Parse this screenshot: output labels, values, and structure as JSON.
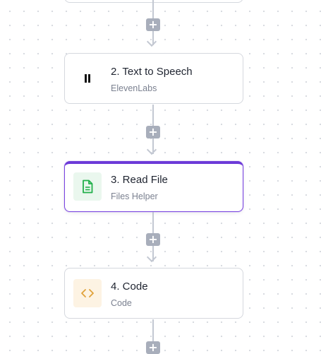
{
  "canvas": {
    "add_step_label": "+"
  },
  "steps": [
    {
      "title": "2. Text to Speech",
      "subtitle": "ElevenLabs",
      "icon": "pause-icon",
      "selected": false
    },
    {
      "title": "3. Read File",
      "subtitle": "Files Helper",
      "icon": "file-icon",
      "selected": true
    },
    {
      "title": "4. Code",
      "subtitle": "Code",
      "icon": "code-icon",
      "selected": false
    }
  ],
  "colors": {
    "accent": "#6c3ad8",
    "connector": "#c3c8d2",
    "add_button": "#a8aebb",
    "file_icon": "#22b04b",
    "file_icon_bg": "#eaf7ee",
    "code_icon": "#e0a23a",
    "code_icon_bg": "#fdf3e3"
  }
}
